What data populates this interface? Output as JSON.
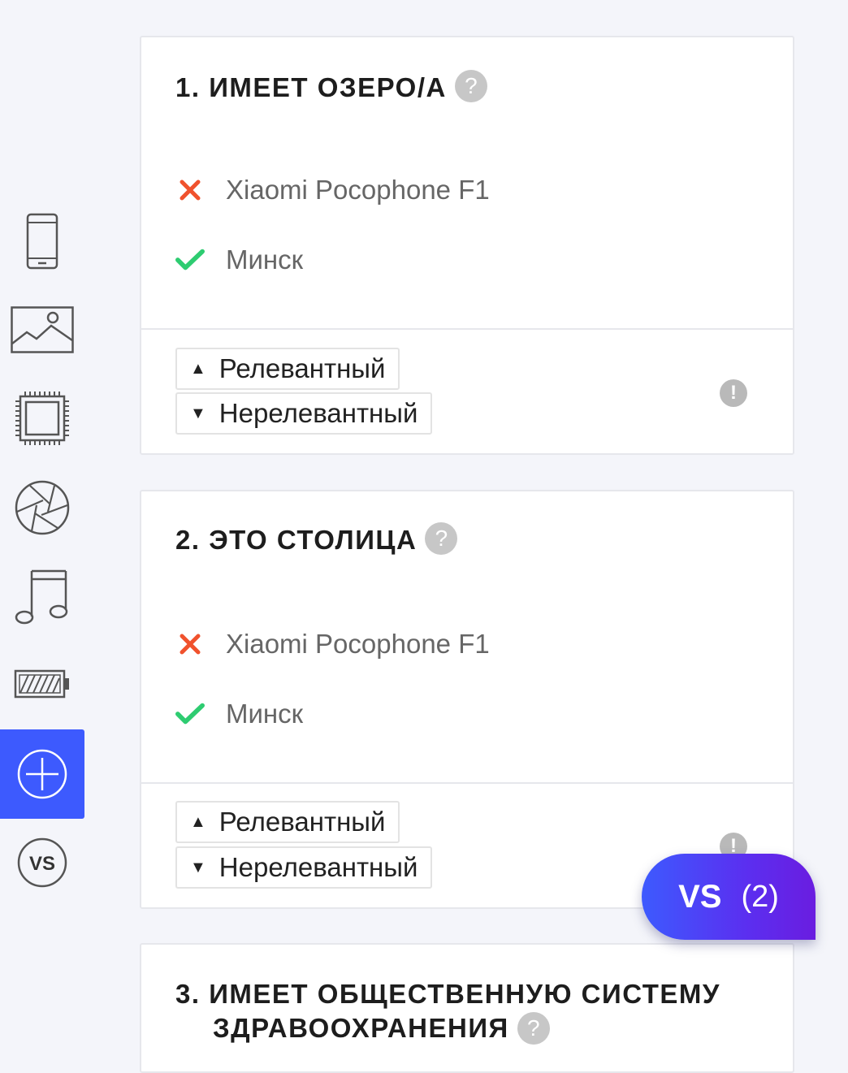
{
  "sidebar": {
    "items": [
      {
        "icon": "phone-icon"
      },
      {
        "icon": "image-icon"
      },
      {
        "icon": "chip-icon"
      },
      {
        "icon": "camera-aperture-icon"
      },
      {
        "icon": "music-icon"
      },
      {
        "icon": "battery-icon"
      },
      {
        "icon": "plus-circle-icon",
        "active": true
      },
      {
        "icon": "vs-icon",
        "label": "VS"
      }
    ]
  },
  "cards": [
    {
      "number": "1.",
      "title": "ИМЕЕТ ОЗЕРО/А",
      "help": "?",
      "rows": [
        {
          "status": "cross",
          "label": "Xiaomi Pocophone F1"
        },
        {
          "status": "check",
          "label": "Минск"
        }
      ],
      "relevant": "Релевантный",
      "irrelevant": "Нерелевантный",
      "report": "!"
    },
    {
      "number": "2.",
      "title": "ЭТО СТОЛИЦА",
      "help": "?",
      "rows": [
        {
          "status": "cross",
          "label": "Xiaomi Pocophone F1"
        },
        {
          "status": "check",
          "label": "Минск"
        }
      ],
      "relevant": "Релевантный",
      "irrelevant": "Нерелевантный",
      "report": "!"
    },
    {
      "number": "3.",
      "title_line1": "ИМЕЕТ ОБЩЕСТВЕННУЮ СИСТЕМУ",
      "title_line2": "ЗДРАВООХРАНЕНИЯ",
      "help": "?"
    }
  ],
  "vs_button": {
    "label": "VS",
    "count": "(2)"
  },
  "colors": {
    "accent": "#3d5afe",
    "cross": "#f0522d",
    "check": "#2ecc71"
  }
}
